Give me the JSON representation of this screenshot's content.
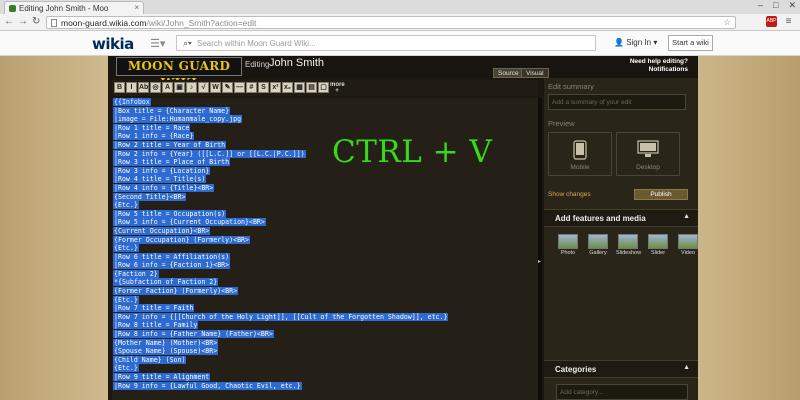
{
  "browser": {
    "tab_title": "Editing John Smith - Moo",
    "tab_close": "×",
    "url_host": "moon-guard.wikia.com",
    "url_path": "/wiki/John_Smith?action=edit",
    "back": "←",
    "forward": "→",
    "reload": "↻",
    "window_buttons": [
      "–",
      "□",
      "✕"
    ],
    "extensions": [
      {
        "name": "abp-icon",
        "label": "ABP",
        "color": "#c11b17"
      },
      {
        "name": "menu-icon",
        "label": "≡",
        "color": "#666666"
      }
    ],
    "star": "☆"
  },
  "wikia_nav": {
    "logo": "wikia",
    "search_placeholder": "Search within Moon Guard Wiki...",
    "sign_in": "Sign In ▾",
    "start_wiki": "Start a wiki"
  },
  "editor": {
    "wiki_logo": "MOON GUARD WIKI",
    "editing_label": "Editing",
    "page_title": "John Smith",
    "tabs": [
      "Source",
      "Visual"
    ],
    "help_line1": "Need help editing?",
    "help_line2": "Notifications",
    "toolbar": [
      {
        "name": "bold-button",
        "label": "B"
      },
      {
        "name": "italic-button",
        "label": "I"
      },
      {
        "name": "internal-link-button",
        "label": "Ab"
      },
      {
        "name": "external-link-button",
        "label": "◎"
      },
      {
        "name": "headline-button",
        "label": "A"
      },
      {
        "name": "image-button",
        "label": "▣"
      },
      {
        "name": "media-button",
        "label": "♪"
      },
      {
        "name": "math-button",
        "label": "√"
      },
      {
        "name": "nowiki-button",
        "label": "W"
      },
      {
        "name": "signature-button",
        "label": "✎"
      },
      {
        "name": "line-button",
        "label": "—"
      },
      {
        "name": "redirect-button",
        "label": "#"
      },
      {
        "name": "strike-button",
        "label": "S"
      },
      {
        "name": "sup-button",
        "label": "x²"
      },
      {
        "name": "sub-button",
        "label": "x₂"
      },
      {
        "name": "gallery-button",
        "label": "▦"
      },
      {
        "name": "table-button",
        "label": "▤"
      },
      {
        "name": "comment-button",
        "label": "▢"
      }
    ],
    "toolbar_more": "more +",
    "overlay_text": "CTRL + V",
    "source_lines": [
      "{{Infobox",
      "|Box title = {Character Name}",
      "|image = File:Humanmale_copy.jpg",
      "|Row 1 title = Race",
      "|Row 1 info = {Race}",
      "|Row 2 title = Year of Birth",
      "|Row 2 info = {Year} ([[L.C.]] or [[L.C.|P.C.]])",
      "|Row 3 title = Place of Birth",
      "|Row 3 info = {Location}",
      "|Row 4 title = Title(s)",
      "|Row 4 info = {Title}<BR>",
      "{Second Title}<BR>",
      "{Etc.}",
      "|Row 5 title = Occupation(s)",
      "|Row 5 info = {Current Occupation}<BR>",
      "{Current Occupation}<BR>",
      "{Former Occupation} (Formerly)<BR>",
      "{Etc.}",
      "|Row 6 title = Affiliation(s)",
      "|Row 6 info = {Faction 1}<BR>",
      "{Faction 2}",
      "*{Subfaction of Faction 2}",
      "{Former Faction} (Formerly)<BR>",
      "{Etc.}",
      "|Row 7 title = Faith",
      "|Row 7 info = {[[Church of the Holy Light]], [[Cult of the Forgotten Shadow]], etc.}",
      "|Row 8 title = Family",
      "|Row 8 info = {Father Name} (Father)<BR>",
      "{Mother Name} (Mother)<BR>",
      "{Spouse Name} (Spouse)<BR>",
      "{Child Name} (Son)",
      "{Etc.}",
      "|Row 9 title = Alignment",
      "|Row 9 info = {Lawful Good, Chaotic Evil, etc.}"
    ]
  },
  "rail": {
    "edit_summary_label": "Edit summary",
    "summary_placeholder": "Add a summary of your edit",
    "preview_label": "Preview",
    "mobile": "Mobile",
    "desktop": "Desktop",
    "show_changes": "Show changes",
    "publish": "Publish",
    "add_features": "Add features and media",
    "media": [
      {
        "name": "photo",
        "label": "Photo"
      },
      {
        "name": "gallery",
        "label": "Gallery"
      },
      {
        "name": "slideshow",
        "label": "Slideshow"
      },
      {
        "name": "slider",
        "label": "Slider"
      },
      {
        "name": "video",
        "label": "Video"
      }
    ],
    "categories": "Categories",
    "category_placeholder": "Add category..."
  }
}
